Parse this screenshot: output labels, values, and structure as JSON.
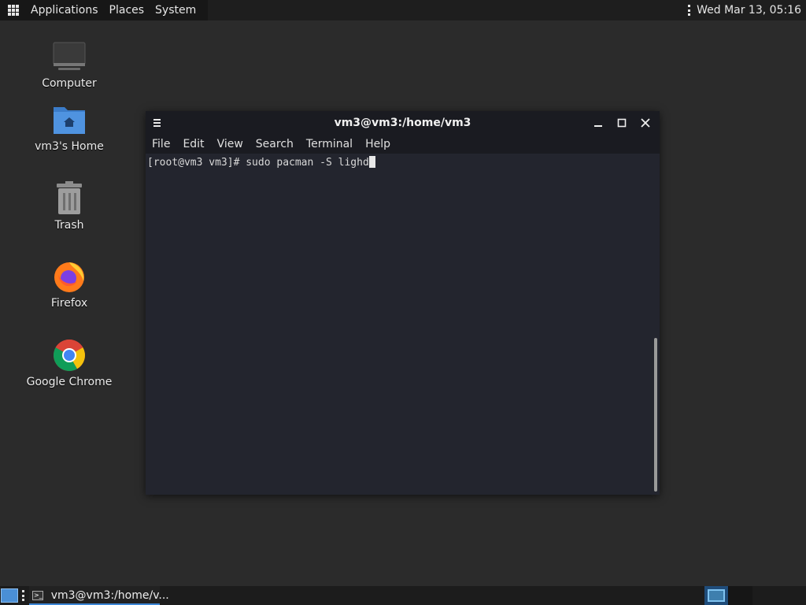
{
  "top_panel": {
    "menus": [
      "Applications",
      "Places",
      "System"
    ],
    "clock": "Wed Mar 13, 05:16"
  },
  "desktop": {
    "icons": [
      {
        "label": "Computer",
        "icon": "computer-icon"
      },
      {
        "label": "vm3's Home",
        "icon": "home-folder-icon"
      },
      {
        "label": "Trash",
        "icon": "trash-icon"
      },
      {
        "label": "Firefox",
        "icon": "firefox-icon"
      },
      {
        "label": "Google Chrome",
        "icon": "chrome-icon"
      }
    ]
  },
  "terminal": {
    "title": "vm3@vm3:/home/vm3",
    "menu": [
      "File",
      "Edit",
      "View",
      "Search",
      "Terminal",
      "Help"
    ],
    "prompt": "[root@vm3 vm3]# ",
    "command": "sudo pacman -S lighd"
  },
  "taskbar": {
    "task_label": "vm3@vm3:/home/v..."
  },
  "colors": {
    "desktop_bg": "#2b2b2b",
    "terminal_bg": "#23252e",
    "accent": "#3d87d6"
  }
}
